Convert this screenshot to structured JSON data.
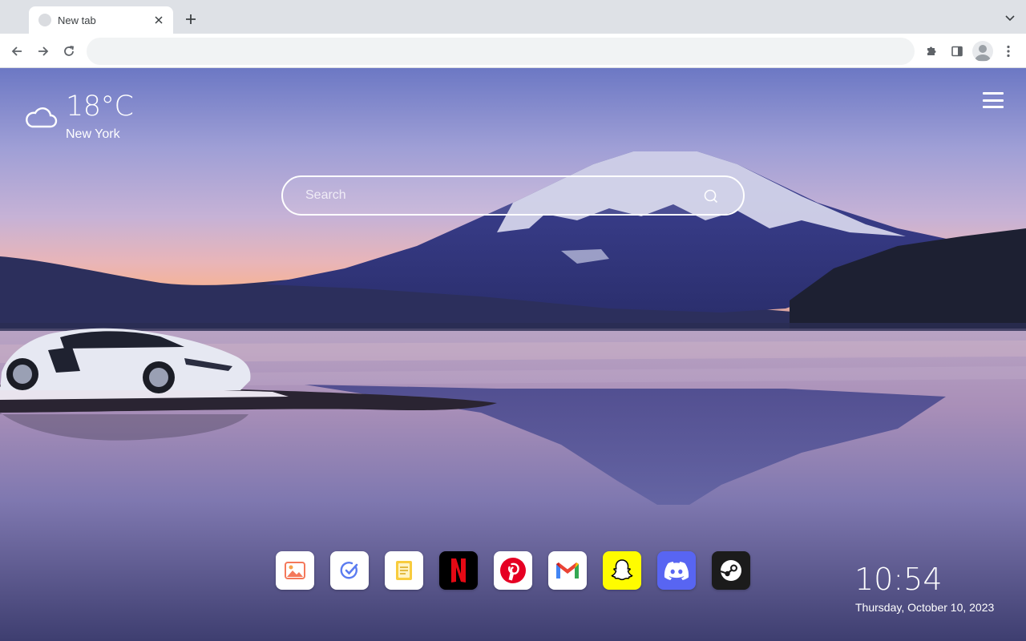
{
  "browser": {
    "tab": {
      "title": "New tab"
    },
    "omnibox": {
      "value": "",
      "placeholder": ""
    }
  },
  "weather": {
    "temperature": "18°C",
    "city": "New York",
    "icon": "cloud-icon"
  },
  "search": {
    "placeholder": "Search"
  },
  "shortcuts": [
    {
      "name": "Gallery",
      "icon": "gallery-icon",
      "bg": "#ffffff"
    },
    {
      "name": "Tasks",
      "icon": "check-circle-icon",
      "bg": "#ffffff"
    },
    {
      "name": "Notes",
      "icon": "notes-icon",
      "bg": "#ffffff"
    },
    {
      "name": "Netflix",
      "icon": "netflix-icon",
      "bg": "#000000"
    },
    {
      "name": "Pinterest",
      "icon": "pinterest-icon",
      "bg": "#ffffff"
    },
    {
      "name": "Gmail",
      "icon": "gmail-icon",
      "bg": "#ffffff"
    },
    {
      "name": "Snapchat",
      "icon": "snapchat-icon",
      "bg": "#fffc00"
    },
    {
      "name": "Discord",
      "icon": "discord-icon",
      "bg": "#5865f2"
    },
    {
      "name": "Steam",
      "icon": "steam-icon",
      "bg": "#1b1b1b"
    }
  ],
  "clock": {
    "time": "10:54",
    "date": "Thursday, October 10, 2023"
  }
}
